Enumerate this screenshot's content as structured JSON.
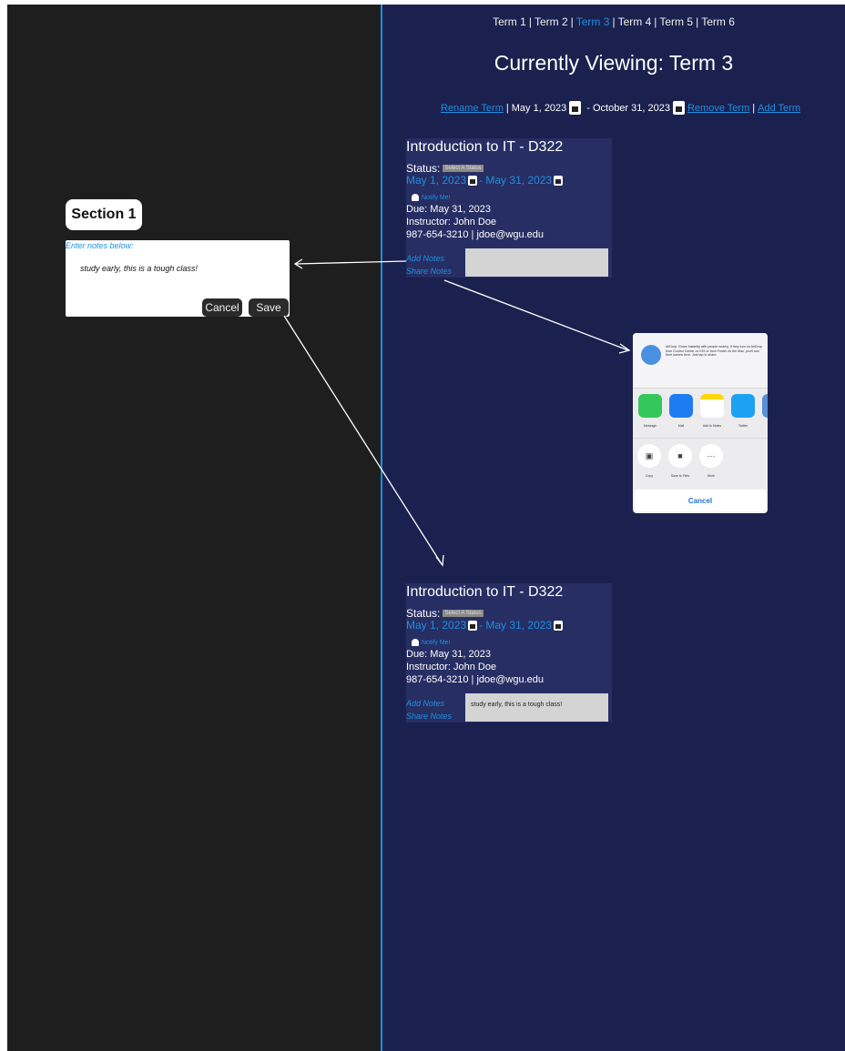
{
  "term_nav": {
    "terms": [
      "Term 1",
      "Term 2",
      "Term 3",
      "Term 4",
      "Term 5",
      "Term 6"
    ],
    "active_index": 2
  },
  "viewing_title": "Currently Viewing: Term 3",
  "term_actions": {
    "rename": "Rename Term",
    "start_date": "May 1, 2023",
    "end_date": "October 31, 2023",
    "remove": "Remove Term",
    "add": "Add Term"
  },
  "section": {
    "label": "Section 1"
  },
  "notes_editor": {
    "hint": "Enter notes below:",
    "text": "study early, this is a tough class!",
    "cancel": "Cancel",
    "save": "Save"
  },
  "course_card": {
    "title": "Introduction to IT - D322",
    "status_label": "Status:",
    "status_select": "Select A Status",
    "start_date": "May 1, 2023",
    "end_date": "May 31, 2023",
    "notify": "Notify Me!",
    "due": "Due: May 31, 2023",
    "instructor": "Instructor: John Doe",
    "contact": "987-654-3210 | jdoe@wgu.edu",
    "add_notes": "Add Notes",
    "share_notes": "Share Notes"
  },
  "saved_notes": "study early, this is a tough class!",
  "share_sheet": {
    "airdrop_text": "AirDrop. Share instantly with people nearby. If they turn on AirDrop from Control Center on iOS or from Finder on the Mac, you'll see their names here. Just tap to share.",
    "apps": [
      {
        "label": "Message",
        "color": "#34c759"
      },
      {
        "label": "Mail",
        "color": "#1e7cf2"
      },
      {
        "label": "Add to Notes",
        "color": "#ffd60a"
      },
      {
        "label": "Twitter",
        "color": "#1da1f2"
      }
    ],
    "actions": [
      "Copy",
      "Save to Files",
      "More"
    ],
    "cancel": "Cancel"
  },
  "colors": {
    "left_bg": "#1e1e1e",
    "right_bg": "#1a214e",
    "card_bg": "#262e63",
    "accent": "#1f8fe0"
  }
}
